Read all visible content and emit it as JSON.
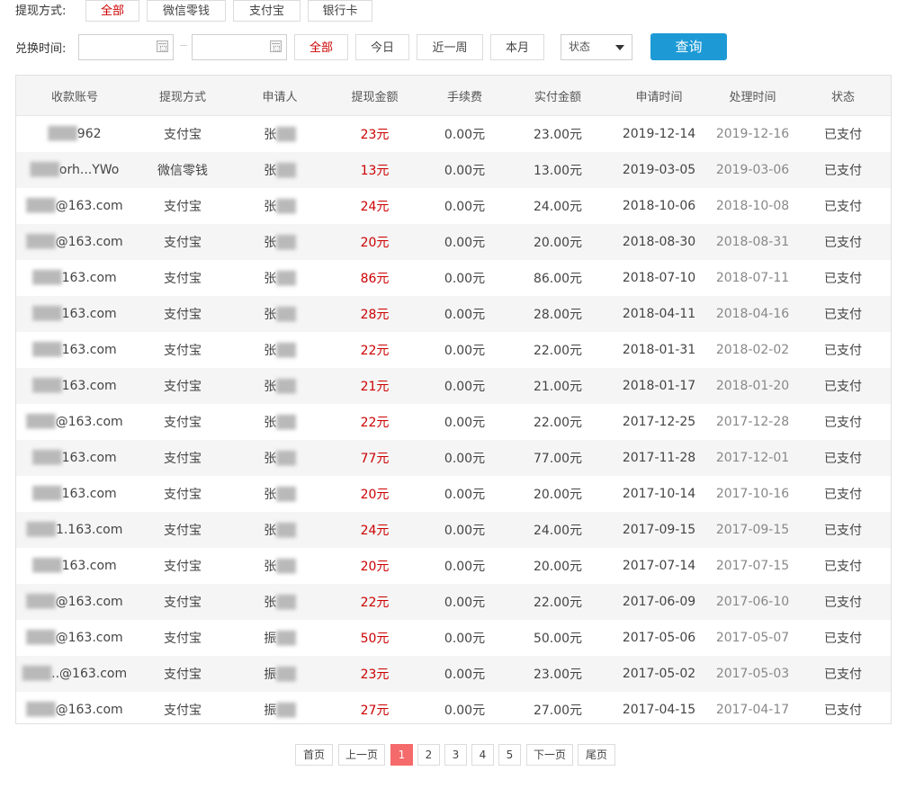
{
  "filters": {
    "method_label": "提现方式:",
    "method_options": [
      {
        "label": "全部",
        "active": true
      },
      {
        "label": "微信零钱",
        "active": false
      },
      {
        "label": "支付宝",
        "active": false
      },
      {
        "label": "银行卡",
        "active": false
      }
    ],
    "time_label": "兑换时间:",
    "start_date": "",
    "end_date": "",
    "time_options": [
      {
        "label": "全部",
        "active": true
      },
      {
        "label": "今日",
        "active": false
      },
      {
        "label": "近一周",
        "active": false
      },
      {
        "label": "本月",
        "active": false
      }
    ],
    "status_select": "状态",
    "query_label": "查询"
  },
  "table": {
    "columns": [
      "收款账号",
      "提现方式",
      "申请人",
      "提现金额",
      "手续费",
      "实付金额",
      "申请时间",
      "处理时间",
      "状态"
    ],
    "rows": [
      {
        "account": "962",
        "method": "支付宝",
        "applicant": "张",
        "amount": "23元",
        "fee": "0.00元",
        "paid": "23.00元",
        "apply_time": "2019-12-14",
        "process_time": "2019-12-16",
        "status": "已支付"
      },
      {
        "account": "orh...YWo",
        "method": "微信零钱",
        "applicant": "张",
        "amount": "13元",
        "fee": "0.00元",
        "paid": "13.00元",
        "apply_time": "2019-03-05",
        "process_time": "2019-03-06",
        "status": "已支付"
      },
      {
        "account": "@163.com",
        "method": "支付宝",
        "applicant": "张",
        "amount": "24元",
        "fee": "0.00元",
        "paid": "24.00元",
        "apply_time": "2018-10-06",
        "process_time": "2018-10-08",
        "status": "已支付"
      },
      {
        "account": "@163.com",
        "method": "支付宝",
        "applicant": "张",
        "amount": "20元",
        "fee": "0.00元",
        "paid": "20.00元",
        "apply_time": "2018-08-30",
        "process_time": "2018-08-31",
        "status": "已支付"
      },
      {
        "account": "163.com",
        "method": "支付宝",
        "applicant": "张",
        "amount": "86元",
        "fee": "0.00元",
        "paid": "86.00元",
        "apply_time": "2018-07-10",
        "process_time": "2018-07-11",
        "status": "已支付"
      },
      {
        "account": "163.com",
        "method": "支付宝",
        "applicant": "张",
        "amount": "28元",
        "fee": "0.00元",
        "paid": "28.00元",
        "apply_time": "2018-04-11",
        "process_time": "2018-04-16",
        "status": "已支付"
      },
      {
        "account": "163.com",
        "method": "支付宝",
        "applicant": "张",
        "amount": "22元",
        "fee": "0.00元",
        "paid": "22.00元",
        "apply_time": "2018-01-31",
        "process_time": "2018-02-02",
        "status": "已支付"
      },
      {
        "account": "163.com",
        "method": "支付宝",
        "applicant": "张",
        "amount": "21元",
        "fee": "0.00元",
        "paid": "21.00元",
        "apply_time": "2018-01-17",
        "process_time": "2018-01-20",
        "status": "已支付"
      },
      {
        "account": "@163.com",
        "method": "支付宝",
        "applicant": "张",
        "amount": "22元",
        "fee": "0.00元",
        "paid": "22.00元",
        "apply_time": "2017-12-25",
        "process_time": "2017-12-28",
        "status": "已支付"
      },
      {
        "account": "163.com",
        "method": "支付宝",
        "applicant": "张",
        "amount": "77元",
        "fee": "0.00元",
        "paid": "77.00元",
        "apply_time": "2017-11-28",
        "process_time": "2017-12-01",
        "status": "已支付"
      },
      {
        "account": "163.com",
        "method": "支付宝",
        "applicant": "张",
        "amount": "20元",
        "fee": "0.00元",
        "paid": "20.00元",
        "apply_time": "2017-10-14",
        "process_time": "2017-10-16",
        "status": "已支付"
      },
      {
        "account": "1.163.com",
        "method": "支付宝",
        "applicant": "张",
        "amount": "24元",
        "fee": "0.00元",
        "paid": "24.00元",
        "apply_time": "2017-09-15",
        "process_time": "2017-09-15",
        "status": "已支付"
      },
      {
        "account": "163.com",
        "method": "支付宝",
        "applicant": "张",
        "amount": "20元",
        "fee": "0.00元",
        "paid": "20.00元",
        "apply_time": "2017-07-14",
        "process_time": "2017-07-15",
        "status": "已支付"
      },
      {
        "account": "@163.com",
        "method": "支付宝",
        "applicant": "张",
        "amount": "22元",
        "fee": "0.00元",
        "paid": "22.00元",
        "apply_time": "2017-06-09",
        "process_time": "2017-06-10",
        "status": "已支付"
      },
      {
        "account": "@163.com",
        "method": "支付宝",
        "applicant": "振",
        "amount": "50元",
        "fee": "0.00元",
        "paid": "50.00元",
        "apply_time": "2017-05-06",
        "process_time": "2017-05-07",
        "status": "已支付"
      },
      {
        "account": "..@163.com",
        "method": "支付宝",
        "applicant": "振",
        "amount": "23元",
        "fee": "0.00元",
        "paid": "23.00元",
        "apply_time": "2017-05-02",
        "process_time": "2017-05-03",
        "status": "已支付"
      },
      {
        "account": "@163.com",
        "method": "支付宝",
        "applicant": "振",
        "amount": "27元",
        "fee": "0.00元",
        "paid": "27.00元",
        "apply_time": "2017-04-15",
        "process_time": "2017-04-17",
        "status": "已支付"
      }
    ]
  },
  "pagination": {
    "first": "首页",
    "prev": "上一页",
    "pages": [
      "1",
      "2",
      "3",
      "4",
      "5"
    ],
    "current": "1",
    "next": "下一页",
    "last": "尾页"
  },
  "colors": {
    "accent_red": "#cc0000",
    "query_blue": "#1d9ad6",
    "page_active": "#f56a6a"
  }
}
